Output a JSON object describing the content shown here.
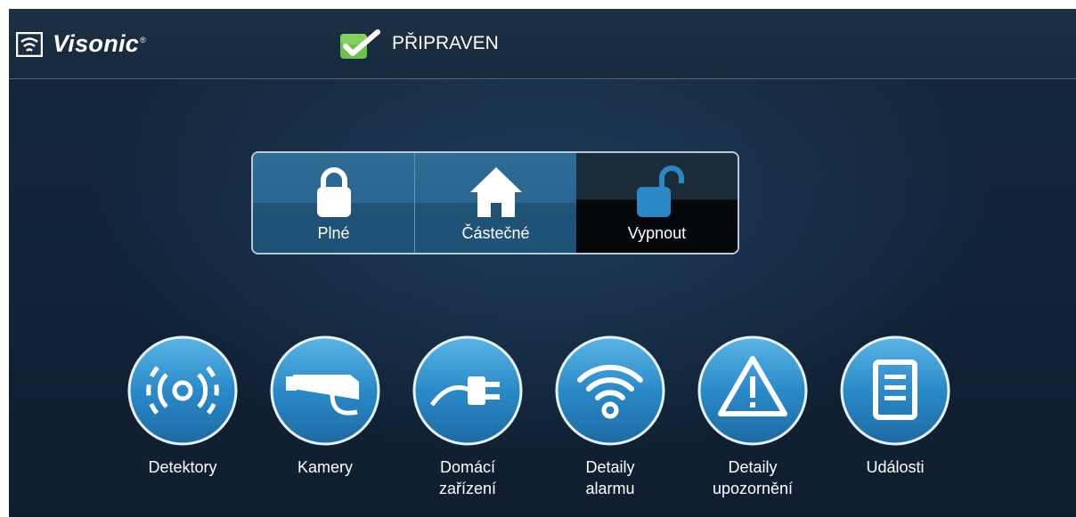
{
  "header": {
    "brand": "Visonic",
    "brand_mark": "®",
    "status_icon": "check-icon",
    "status_text": "PŘIPRAVEN"
  },
  "arm_modes": [
    {
      "label": "Plné",
      "icon": "lock-closed-icon",
      "selected": false
    },
    {
      "label": "Částečné",
      "icon": "home-icon",
      "selected": false
    },
    {
      "label": "Vypnout",
      "icon": "lock-open-icon",
      "selected": true
    }
  ],
  "tiles": [
    {
      "line1": "Detektory",
      "line2": "",
      "icon": "sensor-icon"
    },
    {
      "line1": "Kamery",
      "line2": "",
      "icon": "camera-icon"
    },
    {
      "line1": "Domácí",
      "line2": "zařízení",
      "icon": "plug-icon"
    },
    {
      "line1": "Detaily",
      "line2": "alarmu",
      "icon": "wifi-icon"
    },
    {
      "line1": "Detaily",
      "line2": "upozornění",
      "icon": "warning-icon"
    },
    {
      "line1": "Události",
      "line2": "",
      "icon": "document-icon"
    }
  ],
  "colors": {
    "status_green": "#6cc04a",
    "tile_blue": "#2b88c6",
    "background": "#13243a"
  }
}
